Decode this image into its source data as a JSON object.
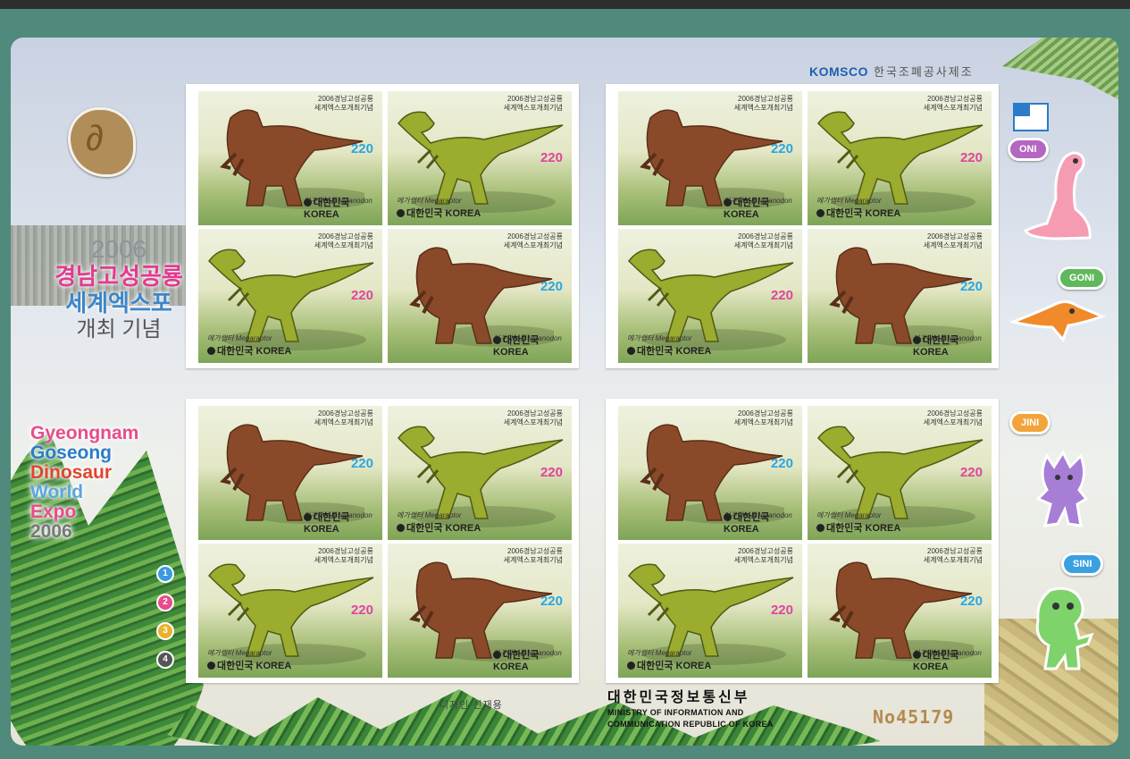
{
  "publisher": {
    "brand": "KOMSCO",
    "korean": "한국조폐공사제조"
  },
  "event_korean": {
    "year": "2006",
    "line1": "경남고성공룡",
    "line2": "세계엑스포",
    "line3": "개최 기념"
  },
  "event_english": [
    "Gyeongnam",
    "Goseong",
    "Dinosaur",
    "World",
    "Expo",
    "2006"
  ],
  "numbers": [
    "1",
    "2",
    "3",
    "4"
  ],
  "characters": [
    "ONI",
    "GONI",
    "JINI",
    "SINI"
  ],
  "stamp": {
    "caption_line1": "2006경남고성공룡",
    "caption_line2": "세계엑스포개최기념",
    "price": "220",
    "iguanodon_name": "이구아노돈 Iguanodon",
    "megaraptor_name": "메가랩터 Megaraptor",
    "country": "대한민국 KOREA"
  },
  "footer": {
    "designer": "디자인 신재용",
    "ministry_korean": "대한민국정보통신부",
    "ministry_english_1": "MINISTRY OF INFORMATION AND",
    "ministry_english_2": "COMMUNICATION REPUBLIC OF KOREA",
    "serial": "No45179"
  },
  "colors": {
    "frame": "#4f8a7d",
    "iguanodon_price": "#29a6e0",
    "megaraptor_price": "#e0449e",
    "komsco": "#1f5fb0"
  },
  "icons": [
    "fossil-stone-icon",
    "grid-logo-icon"
  ]
}
